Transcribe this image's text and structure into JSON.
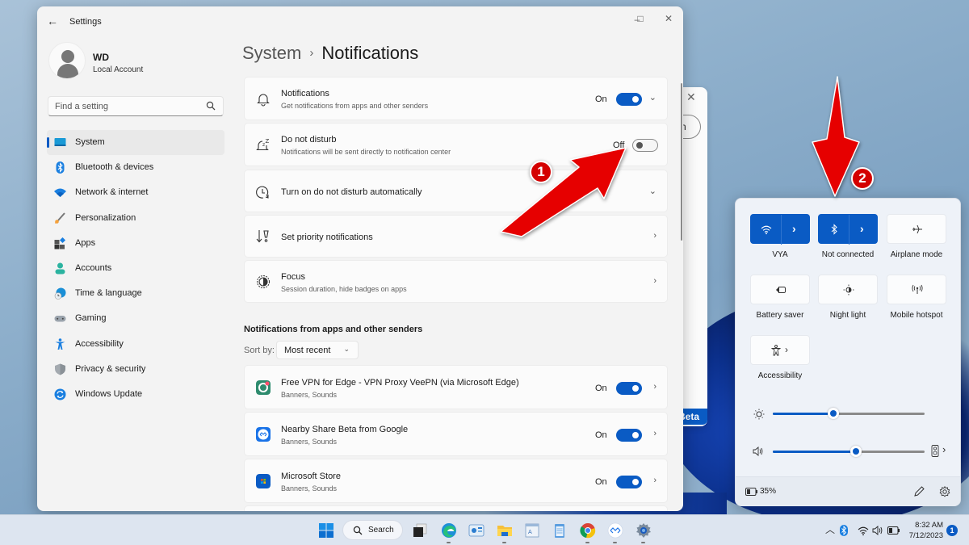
{
  "window": {
    "title": "Settings",
    "back_icon": "back-arrow-icon",
    "controls": {
      "minimize": "–",
      "maximize": "□",
      "close": "✕"
    }
  },
  "profile": {
    "name": "WD",
    "account_type": "Local Account"
  },
  "search": {
    "placeholder": "Find a setting",
    "icon": "search-icon"
  },
  "sidebar": {
    "items": [
      {
        "label": "System",
        "icon": "system-icon",
        "active": true
      },
      {
        "label": "Bluetooth & devices",
        "icon": "bluetooth-icon"
      },
      {
        "label": "Network & internet",
        "icon": "wifi-icon"
      },
      {
        "label": "Personalization",
        "icon": "brush-icon"
      },
      {
        "label": "Apps",
        "icon": "apps-icon"
      },
      {
        "label": "Accounts",
        "icon": "accounts-icon"
      },
      {
        "label": "Time & language",
        "icon": "globe-clock-icon"
      },
      {
        "label": "Gaming",
        "icon": "gamepad-icon"
      },
      {
        "label": "Accessibility",
        "icon": "accessibility-icon"
      },
      {
        "label": "Privacy & security",
        "icon": "shield-icon"
      },
      {
        "label": "Windows Update",
        "icon": "update-icon"
      }
    ]
  },
  "breadcrumb": {
    "parent": "System",
    "separator": "›",
    "current": "Notifications"
  },
  "settings": {
    "notifications": {
      "title": "Notifications",
      "subtitle": "Get notifications from apps and other senders",
      "state": "On",
      "enabled": true
    },
    "dnd": {
      "title": "Do not disturb",
      "subtitle": "Notifications will be sent directly to notification center",
      "state": "Off",
      "enabled": false
    },
    "dnd_auto": {
      "title": "Turn on do not disturb automatically"
    },
    "priority": {
      "title": "Set priority notifications"
    },
    "focus": {
      "title": "Focus",
      "subtitle": "Session duration, hide badges on apps"
    }
  },
  "apps_section": {
    "heading": "Notifications from apps and other senders",
    "sort_label": "Sort by:",
    "sort_value": "Most recent",
    "apps": [
      {
        "name": "Free VPN for Edge - VPN Proxy VeePN (via Microsoft Edge)",
        "detail": "Banners, Sounds",
        "state": "On",
        "enabled": true,
        "color": "#2e8b6e"
      },
      {
        "name": "Nearby Share Beta from Google",
        "detail": "Banners, Sounds",
        "state": "On",
        "enabled": true,
        "color": "#1a73e8"
      },
      {
        "name": "Microsoft Store",
        "detail": "Banners, Sounds",
        "state": "On",
        "enabled": true,
        "color": "#0a5bc4"
      }
    ]
  },
  "background_window": {
    "beta_label": "Beta"
  },
  "quick_settings": {
    "tiles": [
      {
        "label": "VYA",
        "icon": "wifi-icon",
        "on": true,
        "has_arrow": true
      },
      {
        "label": "Not connected",
        "icon": "bluetooth-icon",
        "on": true,
        "has_arrow": true
      },
      {
        "label": "Airplane mode",
        "icon": "airplane-icon",
        "on": false
      },
      {
        "label": "Battery saver",
        "icon": "battery-saver-icon",
        "on": false
      },
      {
        "label": "Night light",
        "icon": "night-light-icon",
        "on": false
      },
      {
        "label": "Mobile hotspot",
        "icon": "hotspot-icon",
        "on": false
      },
      {
        "label": "Accessibility",
        "icon": "accessibility-icon",
        "on": false,
        "has_arrow": true
      }
    ],
    "brightness": 40,
    "volume": 55,
    "battery": "35%"
  },
  "taskbar": {
    "search_label": "Search",
    "apps": [
      "start",
      "search",
      "task-view",
      "edge",
      "photos",
      "file-explorer",
      "wordpad",
      "notepad",
      "chrome",
      "nearby-share",
      "settings"
    ],
    "time": "8:32 AM",
    "date": "7/12/2023",
    "notification_count": "1"
  },
  "annotations": {
    "step1": "1",
    "step2": "2"
  },
  "colors": {
    "accent": "#0a5bc4",
    "annotation": "#e30000"
  }
}
